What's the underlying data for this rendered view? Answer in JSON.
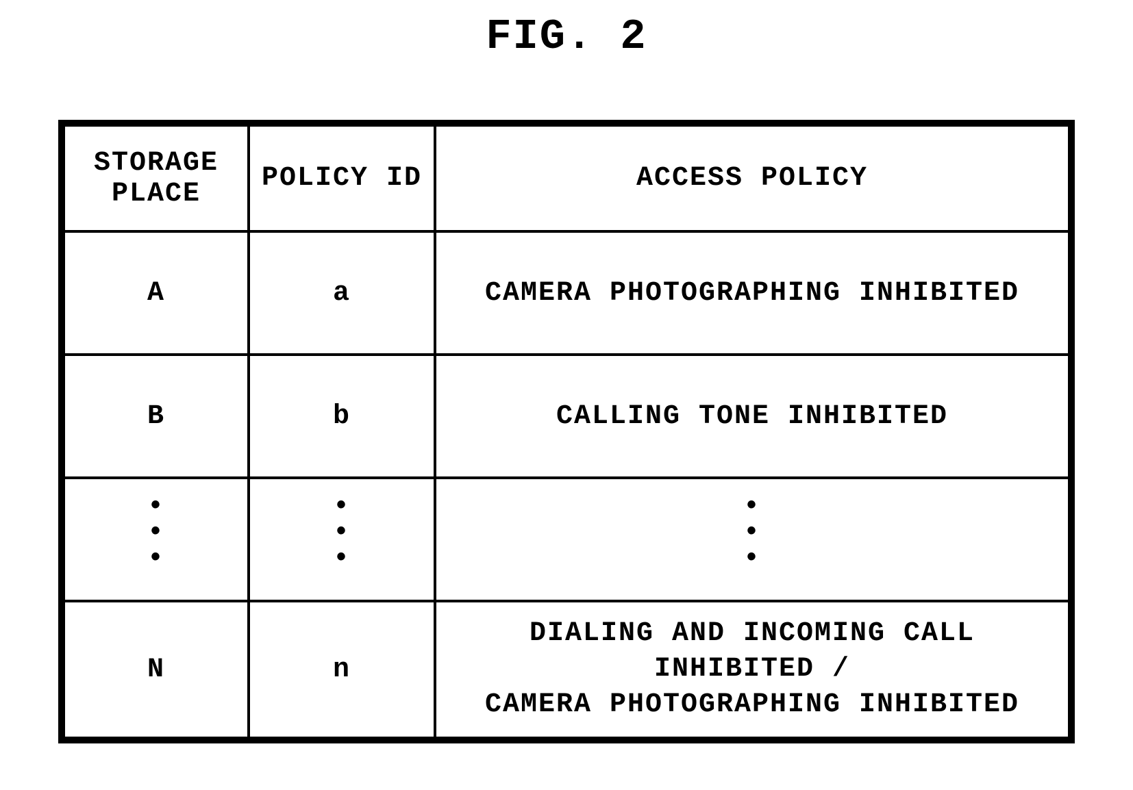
{
  "figure": {
    "title": "FIG. 2"
  },
  "table": {
    "headers": {
      "col1": "STORAGE PLACE",
      "col2": "POLICY ID",
      "col3": "ACCESS POLICY"
    },
    "rows": [
      {
        "storage": "A",
        "policy_id": "a",
        "policy": "CAMERA PHOTOGRAPHING INHIBITED"
      },
      {
        "storage": "B",
        "policy_id": "b",
        "policy": "CALLING TONE INHIBITED"
      },
      {
        "storage": "⋮",
        "policy_id": "⋮",
        "policy": "⋮",
        "ellipsis": true
      },
      {
        "storage": "N",
        "policy_id": "n",
        "policy": "DIALING AND INCOMING CALL INHIBITED / CAMERA PHOTOGRAPHING INHIBITED"
      }
    ]
  }
}
